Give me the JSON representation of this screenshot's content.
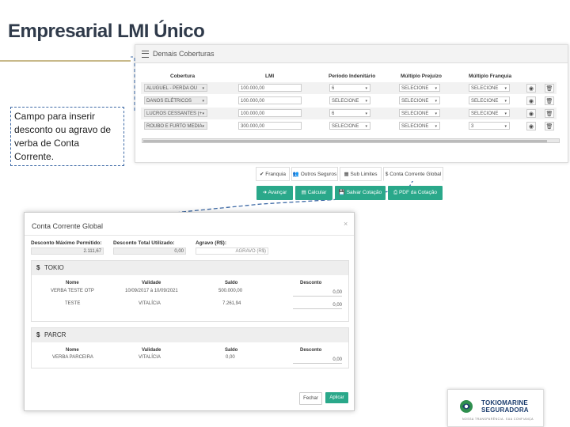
{
  "slide": {
    "title": "Empresarial LMI Único",
    "callout": "Campo para inserir desconto ou agravo de verba de Conta Corrente."
  },
  "coverage_panel": {
    "title": "Demais Coberturas",
    "columns": [
      "Cobertura",
      "LMI",
      "Período Indenitário",
      "Múltiplo Prejuízo",
      "Múltiplo Franquia"
    ],
    "rows": [
      {
        "cobertura": "ALUGUEL - PERDA OU",
        "lmi": "100.000,00",
        "periodo": "6",
        "prejuizo": "SELECIONE",
        "franquia": "SELECIONE"
      },
      {
        "cobertura": "DANOS ELÉTRICOS",
        "lmi": "100.000,00",
        "periodo": "SELECIONE",
        "prejuizo": "SELECIONE",
        "franquia": "SELECIONE"
      },
      {
        "cobertura": "LUCROS CESSANTES (+",
        "lmi": "100.000,00",
        "periodo": "6",
        "prejuizo": "SELECIONE",
        "franquia": "SELECIONE"
      },
      {
        "cobertura": "ROUBO E FURTO MEDIA",
        "lmi": "300.000,00",
        "periodo": "SELECIONE",
        "prejuizo": "SELECIONE",
        "franquia": "3"
      }
    ]
  },
  "tabs": [
    "Franquia",
    "Outros Seguros",
    "Sub Limites",
    "Conta Corrente Global"
  ],
  "actions": [
    "Avançar",
    "Calcular",
    "Salvar Cotação",
    "PDF da Cotação"
  ],
  "modal": {
    "title": "Conta Corrente Global",
    "close": "×",
    "max_label": "Desconto Máximo Permitido:",
    "max_value": "2.111,67",
    "used_label": "Desconto Total Utilizado:",
    "used_value": "0,00",
    "agravo_label": "Agravo (R$):",
    "agravo_placeholder": "AGRAVO (R$)",
    "headers": [
      "Nome",
      "Validade",
      "Saldo",
      "Desconto"
    ],
    "sections": [
      {
        "symbol": "$",
        "name": "TOKIO",
        "rows": [
          {
            "nome": "VERBA TESTE OTP",
            "validade": "10/09/2017 à 10/09/2021",
            "saldo": "500.000,00",
            "desconto": "0,00"
          },
          {
            "nome": "TESTE",
            "validade": "VITALÍCIA",
            "saldo": "7.261,94",
            "desconto": "0,00"
          }
        ]
      },
      {
        "symbol": "$",
        "name": "PARCR",
        "rows": [
          {
            "nome": "VERBA PARCEIRA",
            "validade": "VITALÍCIA",
            "saldo": "0,00",
            "desconto": "0,00"
          }
        ]
      }
    ],
    "btn_close": "Fechar",
    "btn_apply": "Aplicar"
  },
  "logo": {
    "line1": "TOKIOMARINE",
    "line2": "SEGURADORA",
    "tagline": "NOSSA TRANSPARÊNCIA. SUA CONFIANÇA"
  }
}
